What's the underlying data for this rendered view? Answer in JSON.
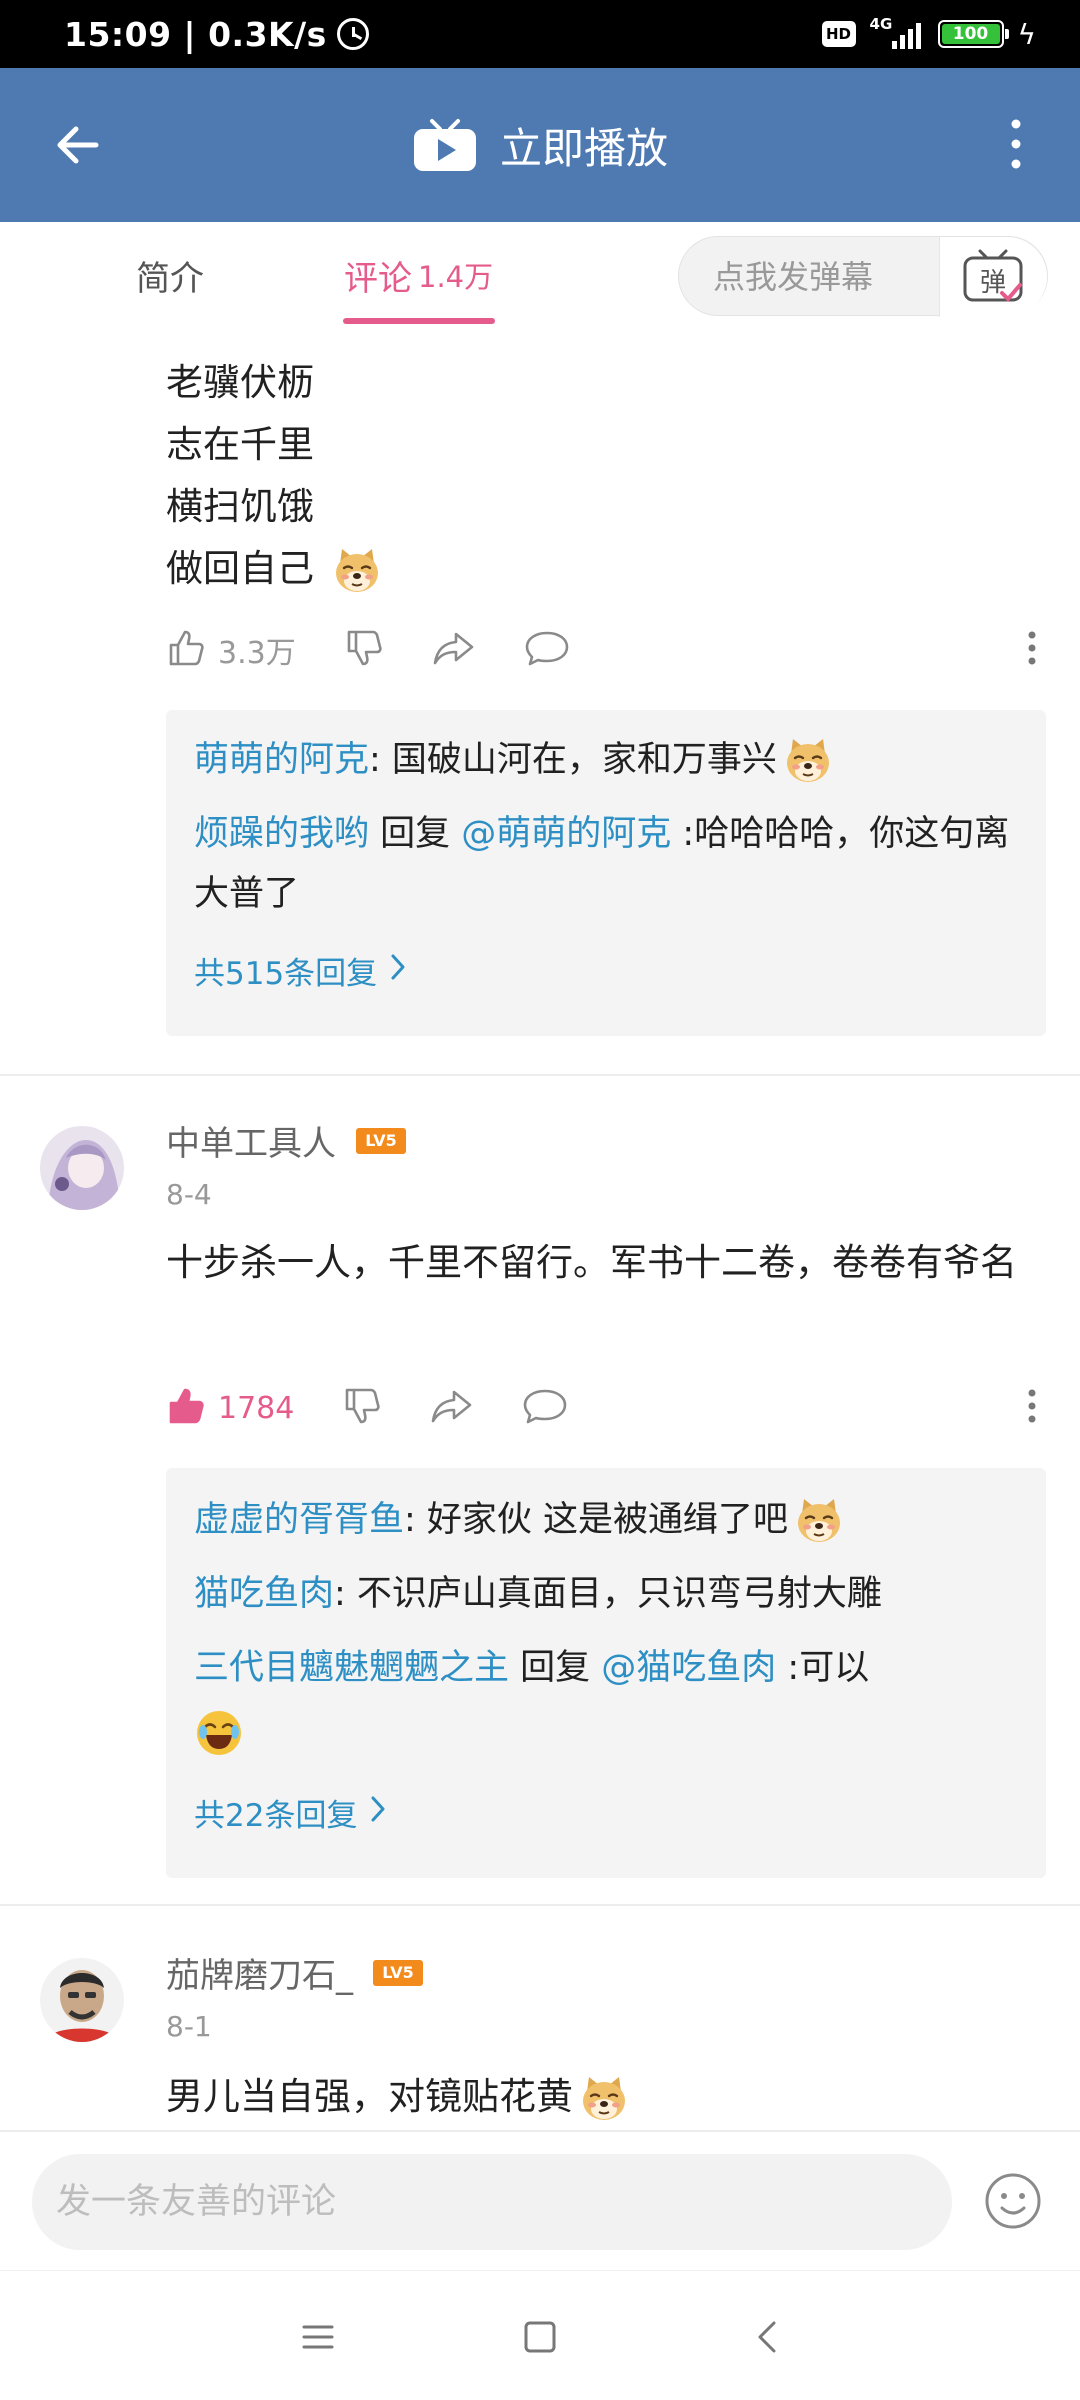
{
  "status_bar": {
    "time": "15:09 | 0.3K/s",
    "hd": "HD",
    "network": "4G",
    "battery": "100"
  },
  "app_bar": {
    "title": "立即播放"
  },
  "tabs": {
    "intro_label": "简介",
    "comments_label": "评论",
    "comments_count": "1.4万",
    "danmaku_placeholder": "点我发弹幕",
    "danmaku_button": "弹"
  },
  "top_comment": {
    "lines": [
      "老骥伏枥",
      "志在千里",
      "横扫饥饿",
      "做回自己"
    ],
    "likes": "3.3万",
    "replies": [
      {
        "user": "萌萌的阿克",
        "text": ": 国破山河在，家和万事兴"
      },
      {
        "user": "烦躁的我哟",
        "reply_word": " 回复 ",
        "mention": "@萌萌的阿克",
        "text": " :哈哈哈哈，你这句离大普了"
      }
    ],
    "more_replies": "共515条回复"
  },
  "comments": [
    {
      "user": "中单工具人",
      "level": "LV5",
      "date": "8-4",
      "text": "十步杀一人，千里不留行。军书十二卷，卷卷有爷名",
      "likes": "1784",
      "replies": [
        {
          "user": "虚虚的胥胥鱼",
          "text": ": 好家伙 这是被通缉了吧"
        },
        {
          "user": "猫吃鱼肉",
          "text": ": 不识庐山真面目，只识弯弓射大雕"
        },
        {
          "user": "三代目魑魅魍魉之主",
          "reply_word": " 回复 ",
          "mention": "@猫吃鱼肉",
          "text": " :可以"
        }
      ],
      "more_replies": "共22条回复"
    },
    {
      "user": "茄牌磨刀石_",
      "level": "LV5",
      "date": "8-1",
      "text": "男儿当自强，对镜贴花黄"
    }
  ],
  "input": {
    "placeholder": "发一条友善的评论"
  },
  "colors": {
    "app_bar": "#4e7ab1",
    "accent_pink": "#e55b8b",
    "link_blue": "#2d8fc4",
    "level_badge": "#f28a1c"
  }
}
